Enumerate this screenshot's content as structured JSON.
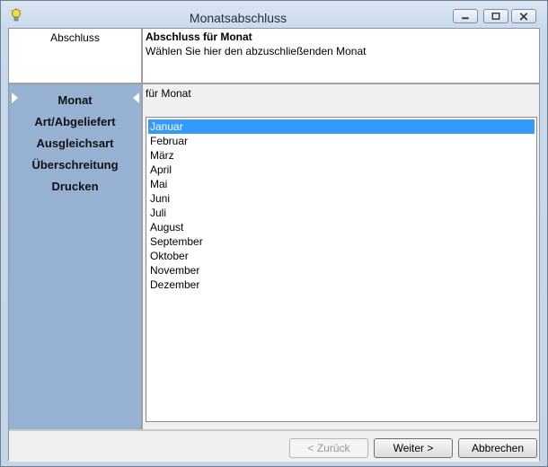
{
  "window": {
    "title": "Monatsabschluss",
    "icon": "lightbulb-icon"
  },
  "header": {
    "section": "Abschluss",
    "title": "Abschluss für Monat",
    "description": "Wählen Sie hier den abzuschließenden Monat"
  },
  "sidebar": {
    "items": [
      {
        "label": "Monat",
        "active": true
      },
      {
        "label": "Art/Abgeliefert",
        "active": false
      },
      {
        "label": "Ausgleichsart",
        "active": false
      },
      {
        "label": "Überschreitung",
        "active": false
      },
      {
        "label": "Drucken",
        "active": false
      }
    ]
  },
  "main": {
    "label": "für Monat",
    "months": [
      "Januar",
      "Februar",
      "März",
      "April",
      "Mai",
      "Juni",
      "Juli",
      "August",
      "September",
      "Oktober",
      "November",
      "Dezember"
    ],
    "selected": "Januar"
  },
  "buttons": {
    "back": "< Zurück",
    "next": "Weiter >",
    "cancel": "Abbrechen"
  },
  "colors": {
    "sidebar": "#96b1d1",
    "selection": "#3399ff"
  }
}
